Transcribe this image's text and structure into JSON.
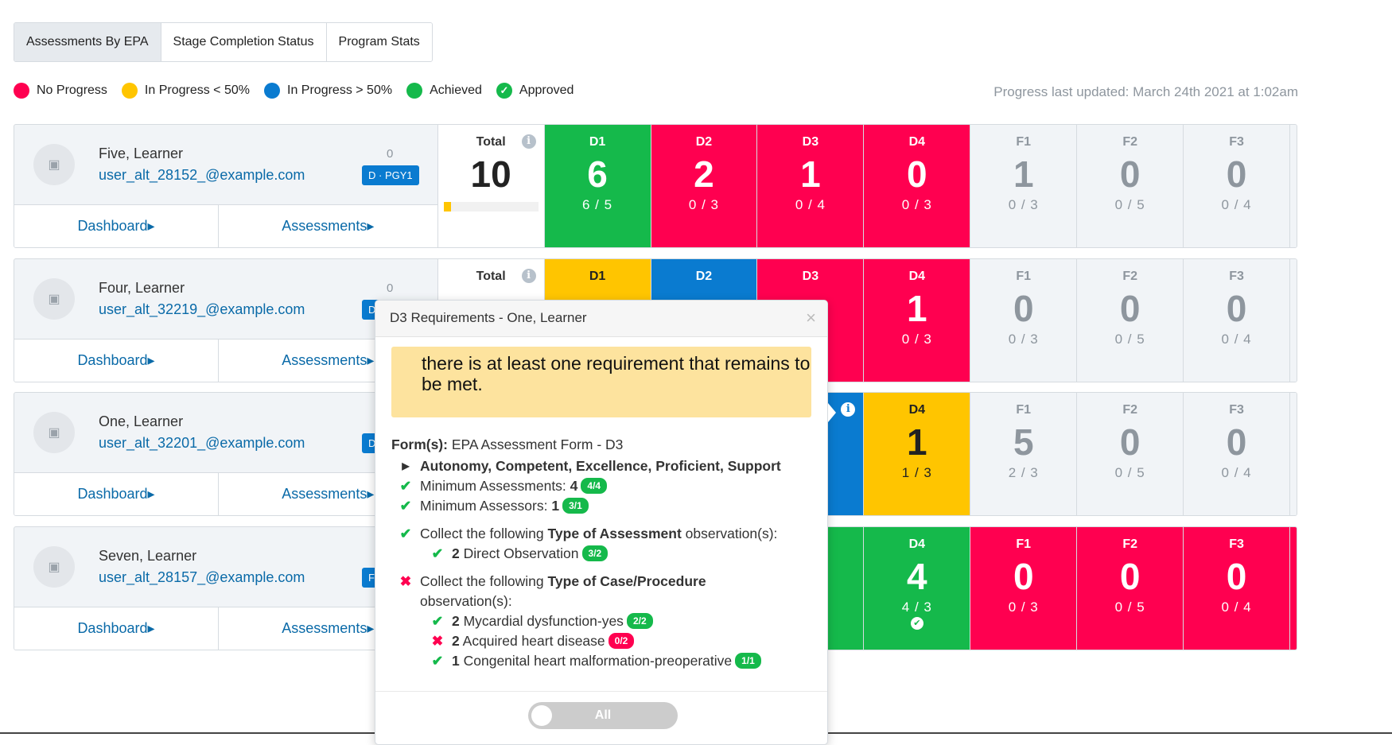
{
  "tabs": [
    {
      "label": "Assessments By EPA",
      "active": true
    },
    {
      "label": "Stage Completion Status"
    },
    {
      "label": "Program Stats"
    }
  ],
  "legend": [
    {
      "label": "No Progress",
      "color": "#ff0050"
    },
    {
      "label": "In Progress < 50%",
      "color": "#ffc500"
    },
    {
      "label": "In Progress > 50%",
      "color": "#0a7bd0"
    },
    {
      "label": "Achieved",
      "color": "#15b94b"
    },
    {
      "label": "Approved",
      "icon": "check-circle-icon",
      "color": "#15b94b"
    }
  ],
  "updated": "Progress last updated: March 24th 2021 at 1:02am",
  "links": {
    "dashboard": "Dashboard",
    "assessments": "Assessments"
  },
  "total_label": "Total",
  "learners": [
    {
      "name": "Five, Learner",
      "email": "user_alt_28152_@example.com",
      "count": "0",
      "badge": "D · PGY1",
      "total": "10",
      "total_progress": 0.08,
      "cells": [
        {
          "label": "D1",
          "value": "6",
          "fraction": "6 / 5",
          "status": "green"
        },
        {
          "label": "D2",
          "value": "2",
          "fraction": "0 / 3",
          "status": "red"
        },
        {
          "label": "D3",
          "value": "1",
          "fraction": "0 / 4",
          "status": "red"
        },
        {
          "label": "D4",
          "value": "0",
          "fraction": "0 / 3",
          "status": "red"
        },
        {
          "label": "F1",
          "value": "1",
          "fraction": "0 / 3",
          "status": "grey"
        },
        {
          "label": "F2",
          "value": "0",
          "fraction": "0 / 5",
          "status": "grey"
        },
        {
          "label": "F3",
          "value": "0",
          "fraction": "0 / 4",
          "status": "grey"
        }
      ]
    },
    {
      "name": "Four, Learner",
      "email": "user_alt_32219_@example.com",
      "count": "0",
      "badge": "D",
      "total": "",
      "cells": []
    },
    {
      "name": "One, Learner",
      "email": "user_alt_32201_@example.com",
      "count": "",
      "badge": "D",
      "total": "",
      "cells": []
    },
    {
      "name": "Seven, Learner",
      "email": "user_alt_28157_@example.com",
      "count": "",
      "badge": "F",
      "total": "",
      "cells": []
    }
  ],
  "popup": {
    "title": "D3 Requirements - One, Learner",
    "warning": "there is at least one requirement that remains to be met.",
    "form_label": "Form(s):",
    "form_value": "EPA Assessment Form - D3",
    "scale": "Autonomy, Competent, Excellence, Proficient, Support",
    "min_assessments": {
      "label": "Minimum Assessments:",
      "value": "4",
      "pill": "4/4",
      "ok": true
    },
    "min_assessors": {
      "label": "Minimum Assessors:",
      "value": "1",
      "pill": "3/1",
      "ok": true
    },
    "type_assessment": {
      "pre": "Collect the following",
      "bold": "Type of Assessment",
      "post": "observation(s):",
      "ok": true,
      "items": [
        {
          "n": "2",
          "label": "Direct Observation",
          "pill": "3/2",
          "ok": true
        }
      ]
    },
    "type_case": {
      "pre": "Collect the following",
      "bold": "Type of Case/Procedure",
      "post": "observation(s):",
      "ok": false,
      "items": [
        {
          "n": "2",
          "label": "Mycardial dysfunction-yes",
          "pill": "2/2",
          "ok": true
        },
        {
          "n": "2",
          "label": "Acquired heart disease",
          "pill": "0/2",
          "ok": false
        },
        {
          "n": "1",
          "label": "Congenital heart malformation-preoperative",
          "pill": "1/1",
          "ok": true
        }
      ]
    },
    "toggle_label": "All"
  }
}
